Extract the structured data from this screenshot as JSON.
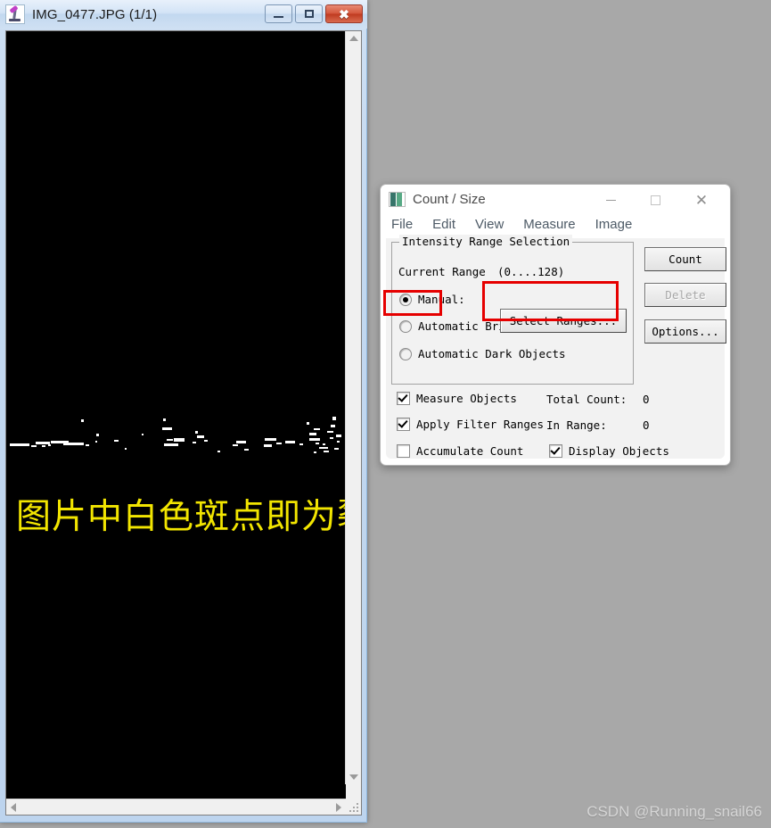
{
  "image_window": {
    "title": "IMG_0477.JPG (1/1)",
    "icon": "microscope-icon",
    "controls": {
      "minimize": "–",
      "maximize": "□",
      "close": "✕"
    },
    "overlay_text": "图片中白色斑点即为裂缝",
    "overlay_color": "#f2e500",
    "canvas_background": "#000000"
  },
  "dialog": {
    "title": "Count / Size",
    "controls": {
      "minimize": "—",
      "maximize": "□",
      "close": "✕"
    },
    "menu": [
      "File",
      "Edit",
      "View",
      "Measure",
      "Image"
    ],
    "group": {
      "label": "Intensity Range Selection",
      "current_range_label": "Current Range",
      "current_range_value": "(0....128)",
      "options": [
        {
          "label": "Manual:",
          "selected": true
        },
        {
          "label": "Automatic Bright Objects",
          "selected": false
        },
        {
          "label": "Automatic Dark Objects",
          "selected": false
        }
      ],
      "select_ranges_button": "Select Ranges..."
    },
    "buttons": [
      {
        "label": "Count",
        "enabled": true
      },
      {
        "label": "Delete",
        "enabled": false
      },
      {
        "label": "Options...",
        "enabled": true
      }
    ],
    "checkboxes": [
      {
        "label": "Measure Objects",
        "checked": true
      },
      {
        "label": "Apply Filter Ranges",
        "checked": true
      },
      {
        "label": "Accumulate Count",
        "checked": false
      },
      {
        "label": "Display Objects",
        "checked": true
      }
    ],
    "readouts": [
      {
        "label": "Total Count:",
        "value": "0"
      },
      {
        "label": "In Range:",
        "value": "0"
      }
    ]
  },
  "annotations": {
    "highlight_color": "#e60000",
    "boxes": [
      "manual-radio",
      "select-ranges-button"
    ]
  },
  "watermark": "CSDN @Running_snail66"
}
